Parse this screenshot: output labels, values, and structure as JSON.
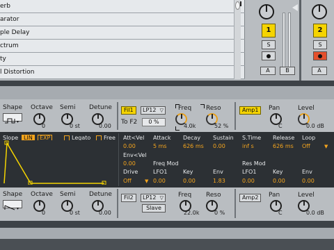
{
  "browser": {
    "items": [
      "erb",
      "arator",
      "ple Delay",
      "ctrum",
      "ty",
      "l Distortion"
    ]
  },
  "mixer": {
    "track1": {
      "number": "1",
      "solo": "S",
      "a": "A",
      "b": "B"
    },
    "track2": {
      "number": "2",
      "solo": "S",
      "a": "A"
    }
  },
  "osc1": {
    "shape_label": "Shape",
    "octave_label": "Octave",
    "octave_value": "0",
    "semi_label": "Semi",
    "semi_value": "0 st",
    "detune_label": "Detune",
    "detune_value": "0.00"
  },
  "fil1": {
    "button": "Fil1",
    "type": "LP12",
    "to_f2_label": "To F2",
    "to_f2_value": "0 %",
    "freq_label": "Freq",
    "freq_value": "4.0k",
    "reso_label": "Reso",
    "reso_value": "52 %"
  },
  "amp1": {
    "button": "Amp1",
    "pan_label": "Pan",
    "pan_value": "C",
    "level_label": "Level",
    "level_value": "0.0 dB"
  },
  "env": {
    "slope_label": "Slope",
    "lin": "LIN",
    "exp": "EXP",
    "legato": "Legato",
    "free": "Free",
    "att_vel_label": "Att<Vel",
    "att_vel_value": "0.00",
    "attack_label": "Attack",
    "attack_value": "5 ms",
    "decay_label": "Decay",
    "decay_value": "626 ms",
    "sustain_label": "Sustain",
    "sustain_value": "0.00",
    "stime_label": "S.Time",
    "stime_value": "inf s",
    "release_label": "Release",
    "release_value": "626 ms",
    "loop_label": "Loop",
    "loop_value": "Off",
    "env_vel_label": "Env<Vel",
    "env_vel_value": "0.00",
    "freq_mod_label": "Freq Mod",
    "res_mod_label": "Res Mod",
    "drive_label": "Drive",
    "drive_value": "Off",
    "lfo1_label": "LFO1",
    "lfo1_value": "0.00",
    "key_label": "Key",
    "key_value": "0.00",
    "env_label": "Env",
    "env_value": "1.83",
    "res_lfo1_label": "LFO1",
    "res_lfo1_value": "0.00",
    "res_key_label": "Key",
    "res_key_value": "0.00",
    "res_env_label": "Env",
    "res_env_value": "0.00"
  },
  "osc2": {
    "shape_label": "Shape",
    "octave_label": "Octave",
    "octave_value": "0",
    "semi_label": "Semi",
    "semi_value": "0 st",
    "detune_label": "Detune",
    "detune_value": "0.00"
  },
  "fil2": {
    "button": "Fil2",
    "type": "LP12",
    "slave": "Slave",
    "freq_label": "Freq",
    "freq_value": "22.0k",
    "reso_label": "Reso",
    "reso_value": "0 %"
  },
  "amp2": {
    "button": "Amp2",
    "pan_label": "Pan",
    "pan_value": "C",
    "level_label": "Level",
    "level_value": "0.0 dB"
  },
  "colors": {
    "accent": "#f5a51d",
    "yellow": "#f5d400",
    "panel": "#b9bdc1",
    "dark": "#2c3034",
    "record": "#e4502d"
  }
}
